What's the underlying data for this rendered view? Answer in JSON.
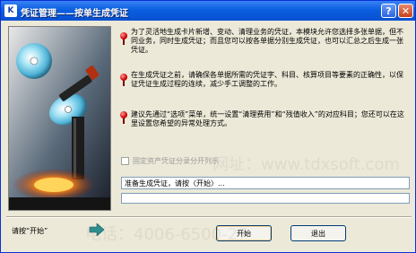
{
  "window": {
    "title": "凭证管理——按单生成凭证",
    "app_icon_text": "K",
    "help_label": "?",
    "close_label": "✕"
  },
  "info": {
    "para1": "为了灵活地生成卡片新增、变动、清理业务的凭证，本模块允许您选择多张单据，但不同业务，同时生成凭证；而且您可以按各单据分别生成凭证，也可以汇总之后生成一张凭证。",
    "para2": "在生成凭证之前，请确保各单据所需的凭证字、科目、核算项目等要素的正确性，以保证凭证生成过程的连续，减少手工调整的工作。",
    "para3": "建议先通过“选项”菜单，统一设置“清理费用”和“残值收入”的对应科目；您还可以在这里设置您希望的异常处理方式。"
  },
  "options": {
    "fixed_asset_label": "固定资产凭证分录分开列示",
    "fixed_asset_checked": false
  },
  "status": {
    "text": "准备生成凭证，请按〈开始〉...",
    "progress": 0
  },
  "footer": {
    "hint": "请按“开始”",
    "start_label": "开始",
    "exit_label": "退出"
  },
  "watermarks": [
    "网址：www.tdxsoft.com",
    "电话：4006-6500-27"
  ],
  "colors": {
    "title_bar": "#0a5fe0",
    "window_bg": "#ece9d8",
    "bullet_red": "#d10000",
    "arrow_teal": "#2a8f8f"
  }
}
